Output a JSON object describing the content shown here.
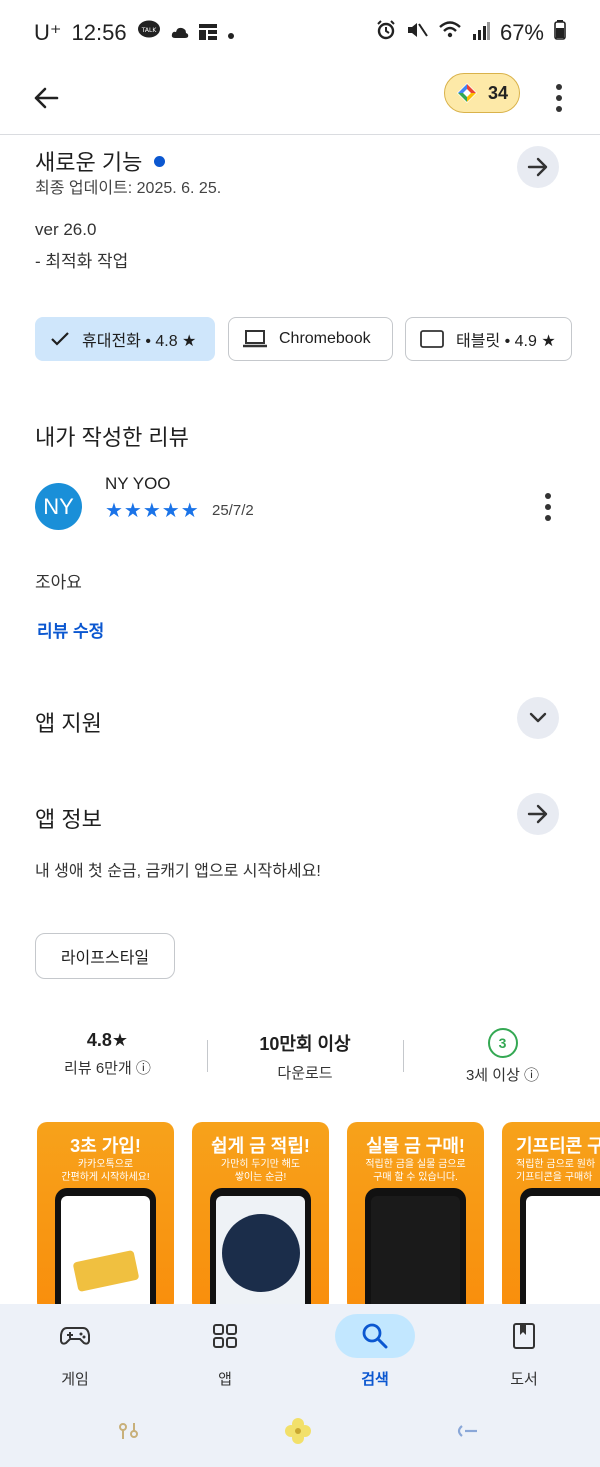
{
  "status_bar": {
    "carrier": "U⁺",
    "time": "12:56",
    "battery": "67%"
  },
  "app_bar": {
    "points": "34"
  },
  "whats_new": {
    "title": "새로운 기능",
    "updated": "최종 업데이트: 2025. 6. 25.",
    "version": "ver 26.0",
    "note": "- 최적화 작업"
  },
  "device_chips": [
    {
      "label": "휴대전화 • 4.8 ★",
      "selected": true,
      "icon": "check-icon"
    },
    {
      "label": "Chromebook",
      "selected": false,
      "icon": "laptop-icon"
    },
    {
      "label": "태블릿 • 4.9 ★",
      "selected": false,
      "icon": "tablet-icon"
    }
  ],
  "my_review": {
    "heading": "내가 작성한 리뷰",
    "avatar_initials": "NY",
    "avatar_color": "#1a8fd8",
    "author": "NY YOO",
    "stars": "★★★★★",
    "date": "25/7/2",
    "text": "조아요",
    "edit_link": "리뷰 수정"
  },
  "app_support": {
    "title": "앱 지원"
  },
  "app_info": {
    "title": "앱 정보",
    "description": "내 생애 첫 순금, 금캐기 앱으로 시작하세요!",
    "category_chip": "라이프스타일"
  },
  "stats": {
    "rating": "4.8★",
    "rating_label": "리뷰 6만개 ⓘ",
    "downloads": "10만회 이상",
    "downloads_label": "다운로드",
    "age_badge": "3",
    "age_label": "3세 이상 ⓘ"
  },
  "screenshots": [
    {
      "title": "3초 가입!",
      "subtitle": "카카오톡으로\n간편하게 시작하세요!"
    },
    {
      "title": "쉽게 금 적립!",
      "subtitle": "가만히 두기만 해도\n쌓이는 순금!"
    },
    {
      "title": "실물 금 구매!",
      "subtitle": "적립한 금을 실물 금으로\n구매 할 수 있습니다."
    },
    {
      "title": "기프티콘 구",
      "subtitle": "적립한 금으로 원하\n기프티콘을 구매하"
    }
  ],
  "bottom_nav": [
    {
      "label": "게임",
      "icon": "gamepad-icon",
      "active": false
    },
    {
      "label": "앱",
      "icon": "apps-grid-icon",
      "active": false
    },
    {
      "label": "검색",
      "icon": "search-icon",
      "active": true
    },
    {
      "label": "도서",
      "icon": "book-icon",
      "active": false
    }
  ],
  "colors": {
    "accent_blue": "#0b57d0",
    "selected_chip": "#cfe6fb",
    "points_bg": "#fde9a8",
    "screenshot_orange": "#f98e0c",
    "age_green": "#34a853"
  }
}
